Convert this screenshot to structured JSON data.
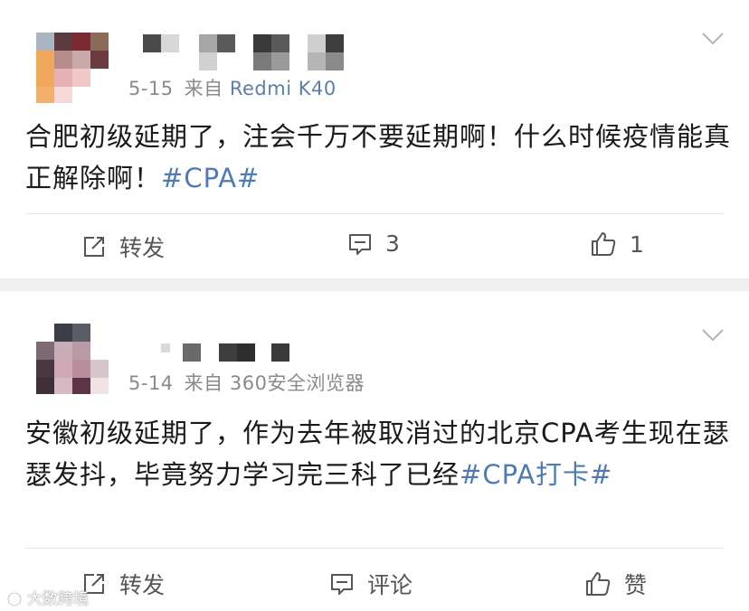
{
  "posts": [
    {
      "date": "5-15",
      "source_prefix": "来自",
      "source": "Redmi K40",
      "text": "合肥初级延期了，注会千万不要延期啊！什么时候疫情能真正解除啊！",
      "hashtag": "#CPA#",
      "actions": {
        "repost": "转发",
        "comments": "3",
        "likes": "1"
      }
    },
    {
      "date": "5-14",
      "source_prefix": "来自",
      "source": "360安全浏览器",
      "text": "安徽初级延期了，作为去年被取消过的北京CPA考生现在瑟瑟发抖，毕竟努力学习完三科了已经",
      "hashtag": "#CPA打卡#",
      "actions": {
        "repost": "转发",
        "comments": "评论",
        "likes": "赞"
      }
    }
  ],
  "watermark": "大数跨境",
  "colors": {
    "link": "#4f7bb5",
    "source": "#5b7fa7",
    "meta": "#8a8a8a",
    "separator": "#efefef"
  },
  "icons": [
    "chevron-down-icon",
    "repost-icon",
    "comment-icon",
    "like-icon",
    "watermark-logo-icon"
  ]
}
